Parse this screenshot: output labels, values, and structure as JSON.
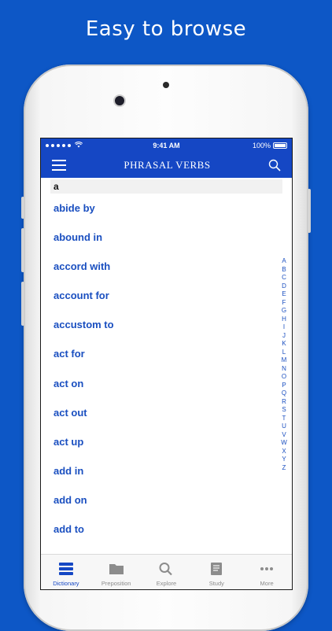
{
  "promo": {
    "headline": "Easy to browse"
  },
  "status_bar": {
    "time": "9:41 AM",
    "battery": "100%"
  },
  "nav": {
    "title": "PHRASAL VERBS",
    "menu_icon": "hamburger-icon",
    "search_icon": "search-icon"
  },
  "section": {
    "letter": "a"
  },
  "entries": [
    "abide by",
    "abound in",
    "accord with",
    "account for",
    "accustom to",
    "act for",
    "act on",
    "act out",
    "act up",
    "add in",
    "add on",
    "add to"
  ],
  "index_letters": [
    "A",
    "B",
    "C",
    "D",
    "E",
    "F",
    "G",
    "H",
    "I",
    "J",
    "K",
    "L",
    "M",
    "N",
    "O",
    "P",
    "Q",
    "R",
    "S",
    "T",
    "U",
    "V",
    "W",
    "X",
    "Y",
    "Z"
  ],
  "tabs": [
    {
      "label": "Dictionary",
      "icon": "stack-icon",
      "active": true
    },
    {
      "label": "Preposition",
      "icon": "folder-icon",
      "active": false
    },
    {
      "label": "Explore",
      "icon": "search-icon",
      "active": false
    },
    {
      "label": "Study",
      "icon": "notebook-icon",
      "active": false
    },
    {
      "label": "More",
      "icon": "ellipsis-icon",
      "active": false
    }
  ],
  "colors": {
    "brand_blue": "#1547c4",
    "background_blue": "#0d57c6",
    "link_blue": "#1a4fc0"
  }
}
